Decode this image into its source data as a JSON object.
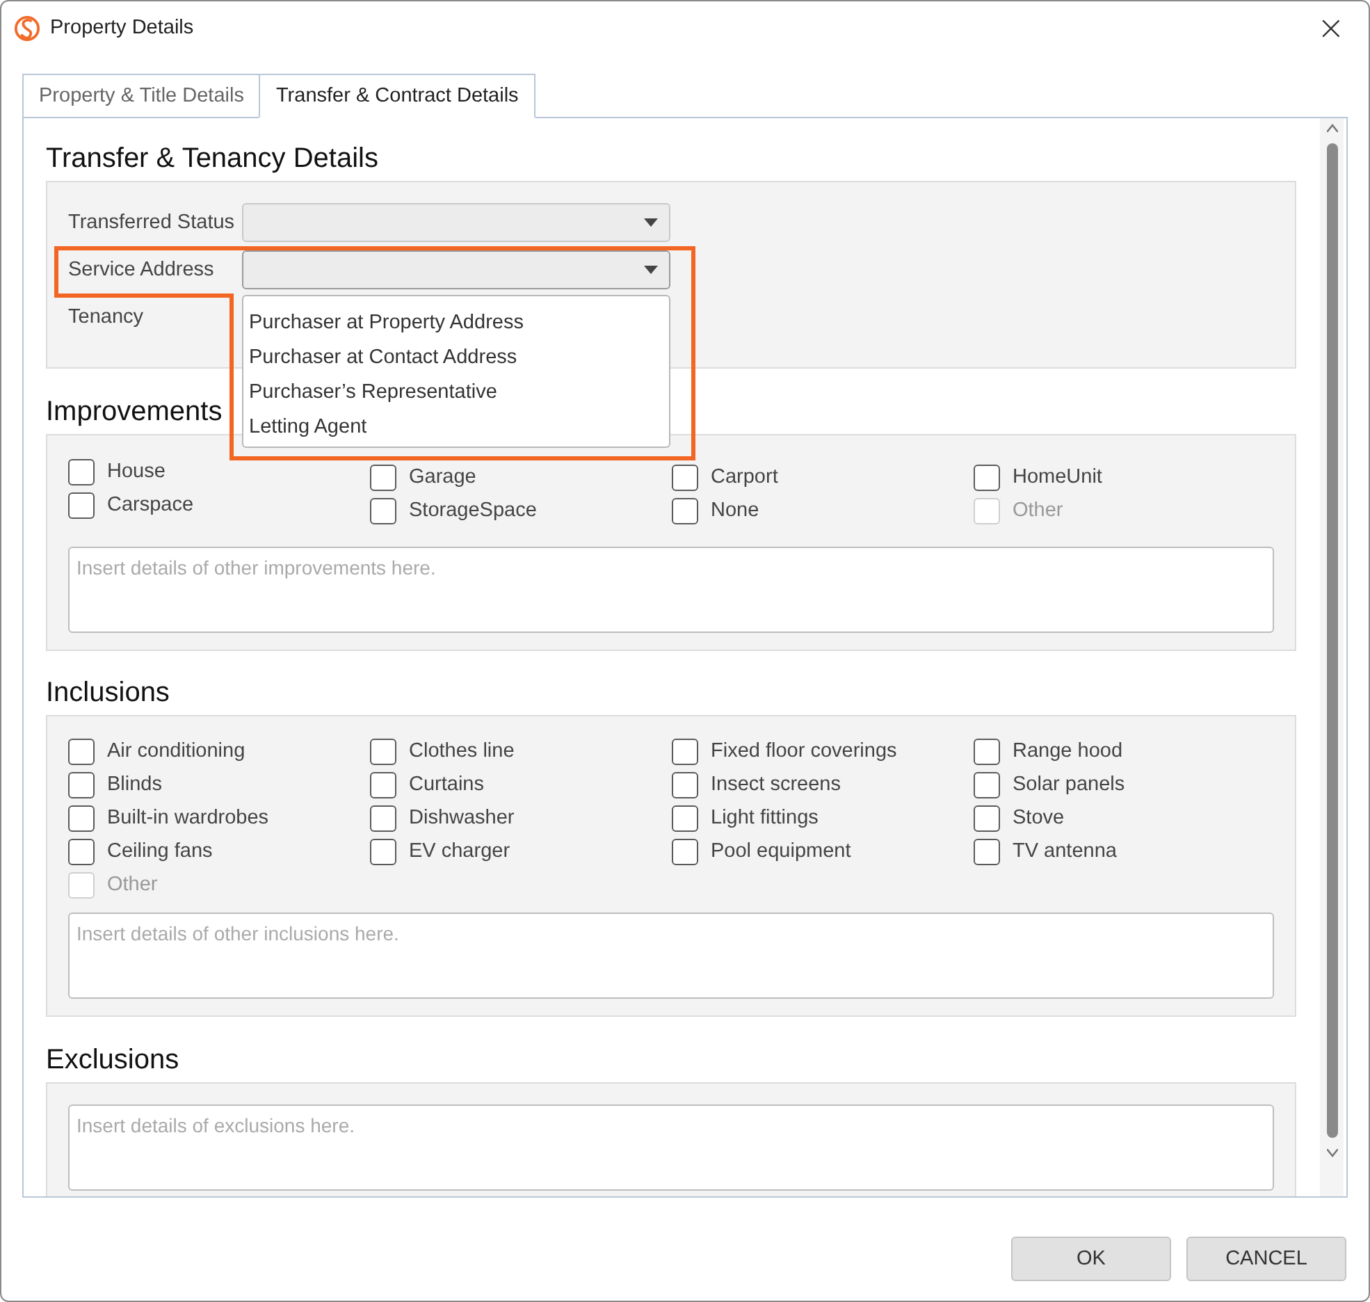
{
  "window": {
    "title": "Property Details",
    "close": "×"
  },
  "tabs": [
    {
      "label": "Property & Title Details",
      "selected": false
    },
    {
      "label": "Transfer & Contract Details",
      "selected": true
    }
  ],
  "transfer": {
    "heading": "Transfer & Tenancy Details",
    "rows": [
      {
        "kind": "combo",
        "label": "Transferred Status",
        "expanded": false,
        "options": []
      },
      {
        "kind": "combo",
        "label": "Service Address",
        "expanded": true,
        "options": [
          "Purchaser at Property Address",
          "Purchaser at Contact Address",
          "Purchaser’s Representative",
          "Letting Agent"
        ]
      },
      {
        "kind": "label",
        "label": "Tenancy"
      }
    ]
  },
  "improvements": {
    "heading": "Improvements",
    "columns": [
      [
        {
          "label": "House",
          "checked": false,
          "disabled": false
        },
        {
          "label": "Carspace",
          "checked": false,
          "disabled": false
        }
      ],
      [
        {
          "label": "Garage",
          "checked": false,
          "disabled": false
        },
        {
          "label": "StorageSpace",
          "checked": false,
          "disabled": false
        }
      ],
      [
        {
          "label": "Carport",
          "checked": false,
          "disabled": false
        },
        {
          "label": "None",
          "checked": false,
          "disabled": false
        }
      ],
      [
        {
          "label": "HomeUnit",
          "checked": false,
          "disabled": false
        },
        {
          "label": "Other",
          "checked": false,
          "disabled": true
        }
      ]
    ],
    "placeholder": "Insert details of other improvements here."
  },
  "inclusions": {
    "heading": "Inclusions",
    "columns": [
      [
        {
          "label": "Air conditioning",
          "checked": false,
          "disabled": false
        },
        {
          "label": "Blinds",
          "checked": false,
          "disabled": false
        },
        {
          "label": "Built-in wardrobes",
          "checked": false,
          "disabled": false
        },
        {
          "label": "Ceiling fans",
          "checked": false,
          "disabled": false
        },
        {
          "label": "Other",
          "checked": false,
          "disabled": true
        }
      ],
      [
        {
          "label": "Clothes line",
          "checked": false,
          "disabled": false
        },
        {
          "label": "Curtains",
          "checked": false,
          "disabled": false
        },
        {
          "label": "Dishwasher",
          "checked": false,
          "disabled": false
        },
        {
          "label": "EV charger",
          "checked": false,
          "disabled": false
        }
      ],
      [
        {
          "label": "Fixed floor coverings",
          "checked": false,
          "disabled": false
        },
        {
          "label": "Insect screens",
          "checked": false,
          "disabled": false
        },
        {
          "label": "Light fittings",
          "checked": false,
          "disabled": false
        },
        {
          "label": "Pool equipment",
          "checked": false,
          "disabled": false
        }
      ],
      [
        {
          "label": "Range hood",
          "checked": false,
          "disabled": false
        },
        {
          "label": "Solar panels",
          "checked": false,
          "disabled": false
        },
        {
          "label": "Stove",
          "checked": false,
          "disabled": false
        },
        {
          "label": "TV antenna",
          "checked": false,
          "disabled": false
        }
      ]
    ],
    "placeholder": "Insert details of other inclusions here."
  },
  "exclusions": {
    "heading": "Exclusions",
    "placeholder": "Insert details of exclusions here."
  },
  "highlight_outline": true,
  "buttons": [
    "OK",
    "CANCEL"
  ]
}
